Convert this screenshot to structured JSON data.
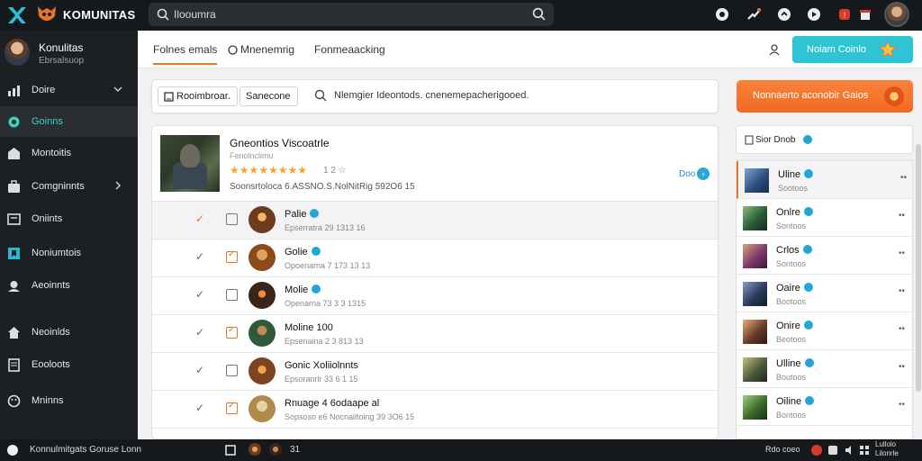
{
  "app": {
    "title": "KOMUNITAS",
    "search_text": "Ilooumra"
  },
  "colors": {
    "accent_orange": "#f06a20",
    "accent_teal": "#2ec4d3",
    "badge_blue": "#21a6d8",
    "sidebar_bg": "#1d2023"
  },
  "topbar_icons": [
    "camera-icon",
    "share-icon",
    "chat-icon",
    "info-icon",
    "notification-icon",
    "gift-icon"
  ],
  "profile": {
    "name": "Konulitas",
    "sub": "Ebrsalsuop"
  },
  "sidebar": {
    "items": [
      {
        "label": "Doire",
        "icon": "chart-icon"
      },
      {
        "label": "Goinns",
        "icon": "gamepad-icon"
      },
      {
        "label": "Montoitis",
        "icon": "store-icon"
      },
      {
        "label": "Comgninnts",
        "icon": "briefcase-icon"
      },
      {
        "label": "Oniints",
        "icon": "monitor-icon"
      },
      {
        "label": "Noniumtois",
        "icon": "bookmark-icon"
      },
      {
        "label": "Aeoinnts",
        "icon": "user-group-icon"
      },
      {
        "label": "Neoinlds",
        "icon": "home-icon"
      },
      {
        "label": "Eooloots",
        "icon": "document-icon"
      },
      {
        "label": "Mninns",
        "icon": "smile-icon"
      }
    ]
  },
  "tabs": [
    {
      "label": "Folnes emals"
    },
    {
      "label": "Mnenemrig"
    },
    {
      "label": "Fonmeaacking"
    }
  ],
  "online_button": "Noiam Coinlo",
  "filter": {
    "chip1": "Rooimbroar.",
    "chip2": "Sanecone",
    "text": "Nlemgier Ideontods. cnenemepacherigooed."
  },
  "orange_button": "Nonnaerto aconobir Gaios",
  "featured": {
    "title": "Gneontios Viscoatrle",
    "subtitle": "Fenolnclimu",
    "stars": "★★★★★★★★",
    "rating": "1 2 ☆",
    "meta": "Soonsrtoloca 6.ASSNO.S.NolNitRig 592O6 15",
    "link": "Doo"
  },
  "rows": [
    {
      "name": "Palie",
      "badge": true,
      "meta": "Epserratra 29 1313 16",
      "checked": false,
      "selected": true,
      "avatar": "#6e3a1c"
    },
    {
      "name": "Golie",
      "badge": true,
      "meta": "Opoenarna 7 173 13 13",
      "checked": true,
      "selected": false,
      "avatar": "#8a4a1a"
    },
    {
      "name": "Molie",
      "badge": true,
      "meta": "Openarna 73 3 3 1315",
      "checked": false,
      "selected": false,
      "avatar": "#3b2418"
    },
    {
      "name": "Moline 100",
      "badge": false,
      "meta": "Epsenaina 2 3 813 13",
      "checked": true,
      "selected": false,
      "avatar": "#2f5a3a"
    },
    {
      "name": "Gonic Xoliiolnnts",
      "badge": false,
      "meta": "Epsoranrlr 33 6 1 15",
      "checked": false,
      "selected": false,
      "avatar": "#7a4520"
    },
    {
      "name": "Rnuage 4 6odaape al",
      "badge": false,
      "meta": "Sopsoso e6 Nocnailtoing 39 3O6 15",
      "checked": true,
      "selected": false,
      "avatar": "#b08a4a"
    }
  ],
  "right_panel": {
    "title": "Sior Dnob",
    "items": [
      {
        "name": "Uline",
        "sub": "Sootoos",
        "color": "#2f4f80",
        "selected": true
      },
      {
        "name": "Onlre",
        "sub": "Sontoos",
        "color": "#2a5a38",
        "selected": false
      },
      {
        "name": "Crlos",
        "sub": "Sontoos",
        "color": "#7a3a6a",
        "selected": false
      },
      {
        "name": "Oaire",
        "sub": "Bootoos",
        "color": "#2a3a5a",
        "selected": false
      },
      {
        "name": "Onire",
        "sub": "Beotoos",
        "color": "#6a3a2a",
        "selected": false
      },
      {
        "name": "Ulline",
        "sub": "Boutoos",
        "color": "#4a5a3a",
        "selected": false
      },
      {
        "name": "Oiline",
        "sub": "Bontoos",
        "color": "#3a6a2a",
        "selected": false
      }
    ]
  },
  "bottombar": {
    "text": "Konnulmitgats Goruse Lonn",
    "count": "31",
    "right": "Rdo coeo",
    "clock_line1": "Lullolo",
    "clock_line2": "Lilonrle"
  }
}
